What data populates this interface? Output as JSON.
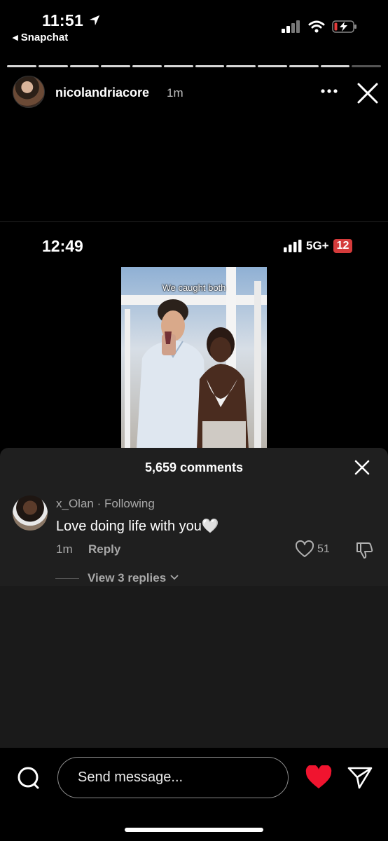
{
  "status_bar": {
    "time": "11:51",
    "back_label": "◂ Snapchat"
  },
  "story": {
    "username": "nicolandriacore",
    "time_ago": "1m",
    "progress_segments": 12,
    "progress_completed": 11
  },
  "embedded_screenshot": {
    "time": "12:49",
    "network": "5G+",
    "battery_percent": "12",
    "video_caption": "We caught both"
  },
  "comments": {
    "count_label": "5,659 comments",
    "items": [
      {
        "username": "x_Olan · Following",
        "text": "Love doing life with you🤍",
        "time": "1m",
        "reply_label": "Reply",
        "likes": "51",
        "view_replies_label": "View 3 replies"
      }
    ]
  },
  "composer": {
    "placeholder": "Send message..."
  },
  "colors": {
    "like_red": "#f0142f",
    "battery_red": "#d53b3b",
    "sheet_bg": "#1f1f1f"
  }
}
